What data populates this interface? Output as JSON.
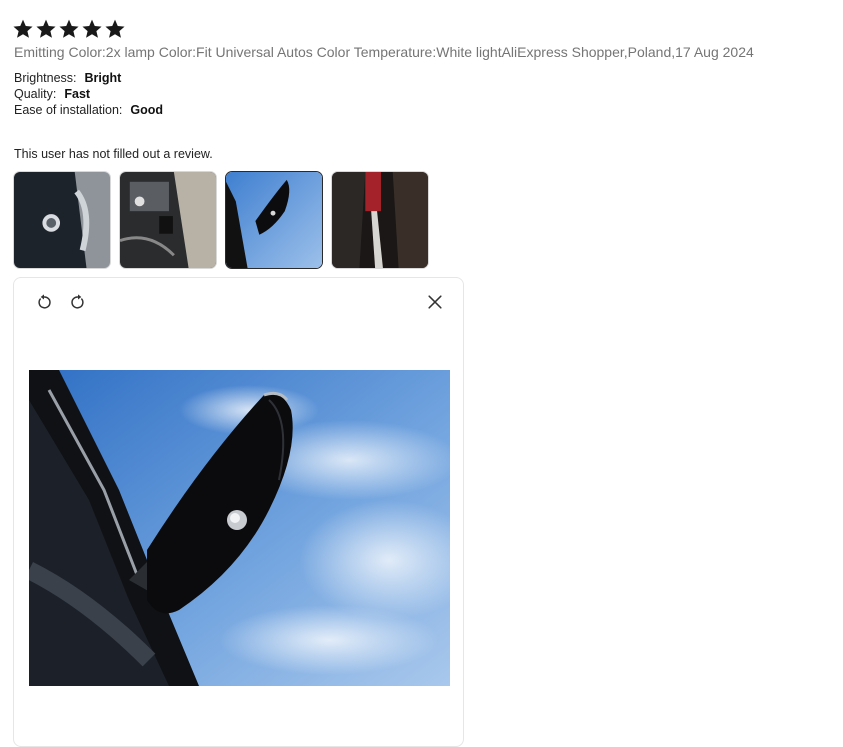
{
  "review": {
    "rating": 5,
    "star_color": "#191919",
    "meta": "Emitting Color:2x lamp Color:Fit Universal Autos Color Temperature:White lightAliExpress Shopper,Poland,17 Aug 2024",
    "attributes": [
      {
        "name": "Brightness:",
        "value": "Bright"
      },
      {
        "name": "Quality:",
        "value": "Fast"
      },
      {
        "name": "Ease of installation:",
        "value": "Good"
      }
    ],
    "text": "This user has not filled out a review."
  },
  "thumbnails": [
    {
      "label": "photo-1",
      "selected": false
    },
    {
      "label": "photo-2",
      "selected": false
    },
    {
      "label": "photo-3",
      "selected": true
    },
    {
      "label": "photo-4",
      "selected": false
    }
  ],
  "viewer": {
    "rotate_left_icon": "rotate-ccw-icon",
    "rotate_right_icon": "rotate-cw-icon",
    "close_icon": "close-icon"
  }
}
